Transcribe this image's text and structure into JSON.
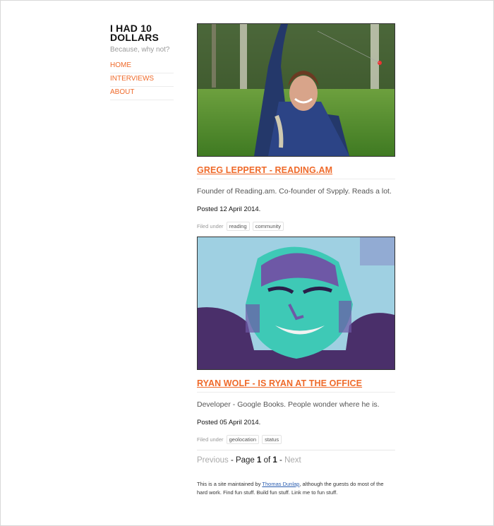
{
  "site": {
    "title_line1": "I HAD 10",
    "title_line2": "DOLLARS",
    "tagline": "Because, why not?"
  },
  "nav": {
    "items": [
      {
        "label": "HOME"
      },
      {
        "label": "INTERVIEWS"
      },
      {
        "label": "ABOUT"
      }
    ]
  },
  "posts": [
    {
      "title": "GREG LEPPERT - READING.AM",
      "excerpt": "Founder of Reading.am. Co-founder of Svpply. Reads a lot.",
      "date": "Posted 12 April 2014.",
      "filed_label": "Filed under",
      "tags": [
        "reading",
        "community"
      ]
    },
    {
      "title": "RYAN WOLF - IS RYAN AT THE OFFICE",
      "excerpt": "Developer - Google Books. People wonder where he is.",
      "date": "Posted 05 April 2014.",
      "filed_label": "Filed under",
      "tags": [
        "geolocation",
        "status"
      ]
    }
  ],
  "pagination": {
    "previous": "Previous",
    "sep1": " - Page ",
    "current": "1",
    "of": " of ",
    "total": "1",
    "sep2": " - ",
    "next": "Next"
  },
  "footer": {
    "prefix": "This is a site maintained by ",
    "link": "Thomas Dunlap",
    "suffix": ", although the guests do most of the hard work. Find fun stuff. Build fun stuff. Link me to fun stuff."
  },
  "colors": {
    "accent": "#ef6a2a",
    "link": "#2a5db0"
  }
}
